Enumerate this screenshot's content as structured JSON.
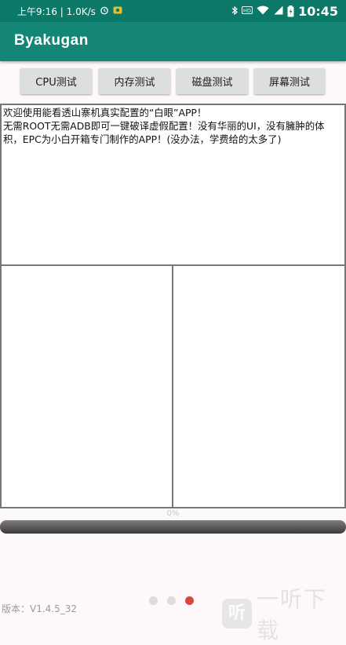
{
  "status_bar": {
    "time_network": "上午9:16 | 1.0K/s",
    "clock": "10:45",
    "icons": [
      "alarm-icon",
      "app-notification-icon",
      "bluetooth-icon",
      "hd-icon",
      "wifi-icon",
      "signal-icon",
      "battery-icon"
    ]
  },
  "app_bar": {
    "title": "Byakugan"
  },
  "toolbar": {
    "buttons": [
      {
        "label": "CPU测试"
      },
      {
        "label": "内存测试"
      },
      {
        "label": "磁盘测试"
      },
      {
        "label": "屏幕测试"
      }
    ]
  },
  "info": {
    "text": "欢迎使用能看透山寨机真实配置的“白眼”APP！\n无需ROOT无需ADB即可一键破译虚假配置！没有华丽的UI，没有臃肿的体积，EPC为小白开箱专门制作的APP！(没办法，学费给的太多了)"
  },
  "progress": {
    "label": "0%",
    "percent": 0
  },
  "pager": {
    "count": 3,
    "active": 2
  },
  "footer": {
    "version": "版本：V1.4.5_32"
  },
  "watermark": {
    "badge": "听",
    "text": "一听下载"
  },
  "colors": {
    "status_bar": "#0c7868",
    "app_bar": "#138675",
    "active_dot": "#d8493c"
  }
}
